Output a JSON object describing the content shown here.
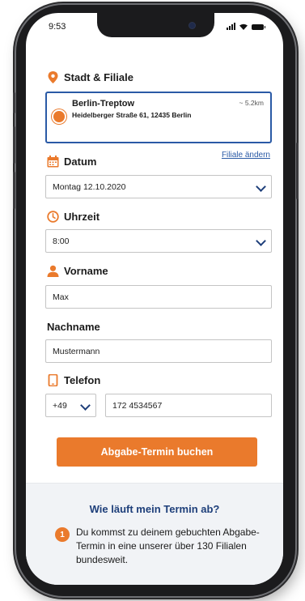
{
  "status_bar": {
    "time": "9:53"
  },
  "location": {
    "section_label": "Stadt & Filiale",
    "branch_name": "Berlin-Treptow",
    "branch_address": "Heidelberger Straße 61, 12435 Berlin",
    "distance": "~ 5.2km",
    "change_link": "Filiale ändern"
  },
  "date": {
    "label": "Datum",
    "value": "Montag 12.10.2020"
  },
  "time": {
    "label": "Uhrzeit",
    "value": "8:00"
  },
  "first_name": {
    "label": "Vorname",
    "value": "Max"
  },
  "last_name": {
    "label": "Nachname",
    "value": "Mustermann"
  },
  "phone": {
    "label": "Telefon",
    "country_code": "+49",
    "number": "172 4534567"
  },
  "book_button": "Abgabe-Termin buchen",
  "info": {
    "title": "Wie läuft mein Termin ab?",
    "step_number": "1",
    "step_text": "Du kommst zu deinem gebuchten Abgabe-Termin in eine unserer über 130 Filialen bundesweit."
  },
  "colors": {
    "accent": "#ea7a2c",
    "primary": "#1e3f7a",
    "selected_border": "#2a5aa6"
  }
}
